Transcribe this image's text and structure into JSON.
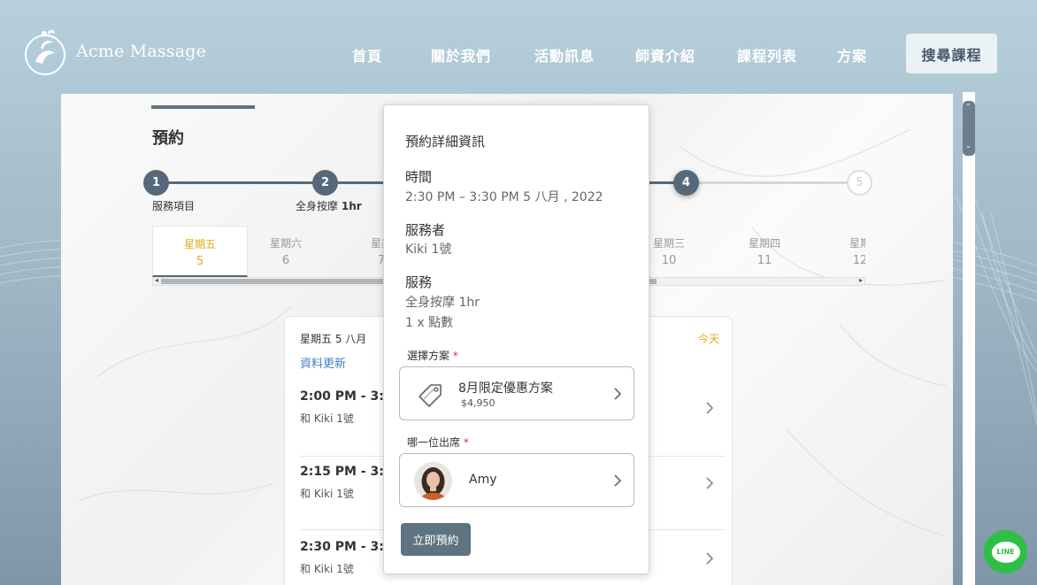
{
  "brand": {
    "name": "Acme Massage"
  },
  "nav": {
    "items": [
      {
        "label": "首頁"
      },
      {
        "label": "關於我們"
      },
      {
        "label": "活動訊息"
      },
      {
        "label": "師資介紹"
      },
      {
        "label": "課程列表"
      },
      {
        "label": "方案"
      }
    ],
    "search_label": "搜尋課程"
  },
  "page": {
    "title": "預約"
  },
  "stepper": {
    "steps": [
      {
        "num": "1",
        "label": "服務項目"
      },
      {
        "num": "2",
        "label_prefix": "全身按摩",
        "label_bold": "1hr"
      },
      {
        "num": "4"
      },
      {
        "num": "5"
      }
    ]
  },
  "dates": [
    {
      "dow": "星期五",
      "day": "5"
    },
    {
      "dow": "星期六",
      "day": "6"
    },
    {
      "dow": "星期",
      "day": "7"
    },
    {
      "dow": "星期三",
      "day": "10"
    },
    {
      "dow": "星期四",
      "day": "11"
    },
    {
      "dow": "星期",
      "day": "12"
    }
  ],
  "schedule": {
    "date_label": "星期五 5 八月",
    "today_label": "今天",
    "refresh_label": "資料更新",
    "slots": [
      {
        "time": "2:00 PM - 3:00",
        "who": "和 Kiki 1號"
      },
      {
        "time": "2:15 PM - 3:15",
        "who": "和 Kiki 1號"
      },
      {
        "time": "2:30 PM - 3:30",
        "who": "和 Kiki 1號"
      }
    ]
  },
  "popup": {
    "title": "預約詳細資訊",
    "time_heading": "時間",
    "time_value": "2:30 PM  –  3:30 PM     5 八月 , 2022",
    "provider_heading": "服務者",
    "provider_value": "Kiki  1號",
    "service_heading": "服務",
    "service_value": "全身按摩 1hr",
    "service_qty": "1 x 點數",
    "plan_label": "選擇方案",
    "plan_name": "8月限定優惠方案",
    "plan_price": "$4,950",
    "attendee_label": "哪一位出席",
    "attendee_name": "Amy",
    "required_mark": "*",
    "book_label": "立即預約"
  },
  "line": {
    "label": "LINE"
  },
  "colors": {
    "accent": "#56697a",
    "highlight": "#e6a817",
    "link": "#4a7fc1",
    "line_green": "#2dbf46"
  }
}
